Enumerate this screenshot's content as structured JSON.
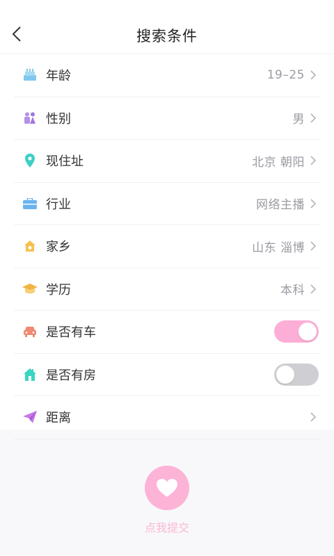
{
  "header": {
    "title": "搜索条件"
  },
  "rows": [
    {
      "label": "年龄",
      "value": "19–25",
      "icon": "cake-icon",
      "color": "#7fc8ee"
    },
    {
      "label": "性别",
      "value": "男",
      "icon": "people-icon",
      "color": "#b58fe8"
    },
    {
      "label": "现住址",
      "value": "北京 朝阳",
      "icon": "location-pin-icon",
      "color": "#3ecfc6"
    },
    {
      "label": "行业",
      "value": "网络主播",
      "icon": "briefcase-icon",
      "color": "#6bb3ee"
    },
    {
      "label": "家乡",
      "value": "山东 淄博",
      "icon": "home-icon",
      "color": "#f5c24f"
    },
    {
      "label": "学历",
      "value": "本科",
      "icon": "graduation-cap-icon",
      "color": "#f0b545"
    },
    {
      "label": "是否有车",
      "value": "",
      "icon": "car-icon",
      "color": "#f08a72",
      "toggle": true
    },
    {
      "label": "是否有房",
      "value": "",
      "icon": "house-icon",
      "color": "#38d6c0",
      "toggle": false
    },
    {
      "label": "距离",
      "value": "",
      "icon": "paper-plane-icon",
      "color": "#c777e6"
    }
  ],
  "submit": {
    "label": "点我提交",
    "color": "#fdb3d6"
  },
  "colors": {
    "toggle_on": "#fdaed6",
    "toggle_off": "#cfcfd3"
  }
}
